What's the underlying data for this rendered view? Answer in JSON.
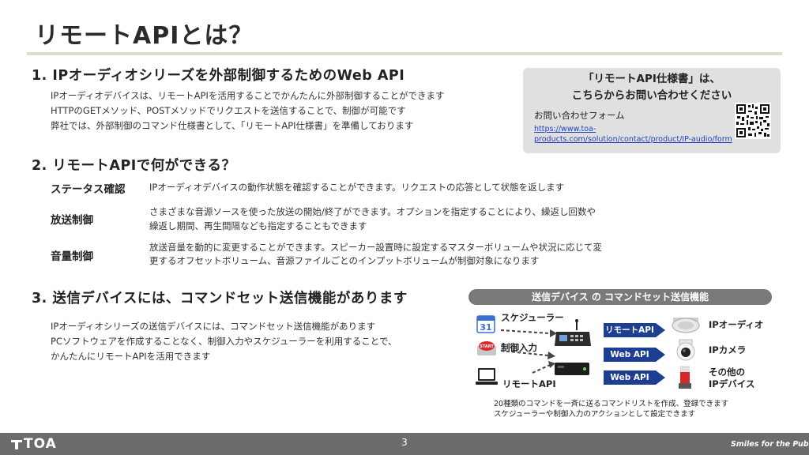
{
  "slide": {
    "title": "リモートAPIとは？",
    "page_number": "3"
  },
  "section1": {
    "heading": "1.  IPオーディオシリーズを外部制御するためのWeb API",
    "lines": [
      "IPオーディオデバイスは、リモートAPIを活用することでかんたんに外部制御することができます",
      "HTTPのGETメソッド、POSTメソッドでリクエストを送信することで、制御が可能です",
      "弊社では、外部制御のコマンド仕様書として、「リモートAPI仕様書」を準備しております"
    ]
  },
  "contact": {
    "heading_line1": "「リモートAPI仕様書」は、",
    "heading_line2": "こちらからお問い合わせください",
    "form_label": "お問い合わせフォーム",
    "url_line1": "https://www.toa-",
    "url_line2": "products.com/solution/contact/product/IP-audio/form"
  },
  "section2": {
    "heading": "2.  リモートAPIで何ができる？",
    "rows": [
      {
        "label": "ステータス確認",
        "lines": [
          "IPオーディオデバイスの動作状態を確認することができます。リクエストの応答として状態を返します"
        ]
      },
      {
        "label": "放送制御",
        "lines": [
          "さまざまな音源ソースを使った放送の開始/終了ができます。オプションを指定することにより、繰返し回数や",
          "繰返し期間、再生間隔なども指定することもできます"
        ]
      },
      {
        "label": "音量制御",
        "lines": [
          "放送音量を動的に変更することができます。スピーカー設置時に設定するマスターボリュームや状況に応じて変",
          "更するオフセットボリューム、音源ファイルごとのインプットボリュームが制御対象になります"
        ]
      }
    ]
  },
  "section3": {
    "heading": "3.  送信デバイスには、コマンドセット送信機能があります",
    "lines": [
      "IPオーディオシリーズの送信デバイスには、コマンドセット送信機能があります",
      "PCソフトウェアを作成することなく、制御入力やスケジューラーを利用することで、",
      "かんたんにリモートAPIを活用できます"
    ]
  },
  "diagram": {
    "header": "送信デバイス の コマンドセット送信機能",
    "calendar_day": "31",
    "start_button_text": "START",
    "inputs": [
      "スケジューラー",
      "制御入力",
      "リモートAPI"
    ],
    "badges": [
      "リモートAPI",
      "Web API",
      "Web API"
    ],
    "outputs": [
      "IPオーディオ",
      "IPカメラ",
      "その他の",
      "IPデバイス"
    ],
    "note_lines": [
      "20種類のコマンドを一斉に送るコマンドリストを作成、登録できます",
      "スケジューラーや制御入力のアクションとして設定できます"
    ]
  },
  "footer": {
    "logo": "TOA",
    "tagline": "Smiles for the Public"
  },
  "colors": {
    "badge_blue": "#1e3f91",
    "footer_gray": "#6b6b6b",
    "link_blue": "#2340c0"
  }
}
